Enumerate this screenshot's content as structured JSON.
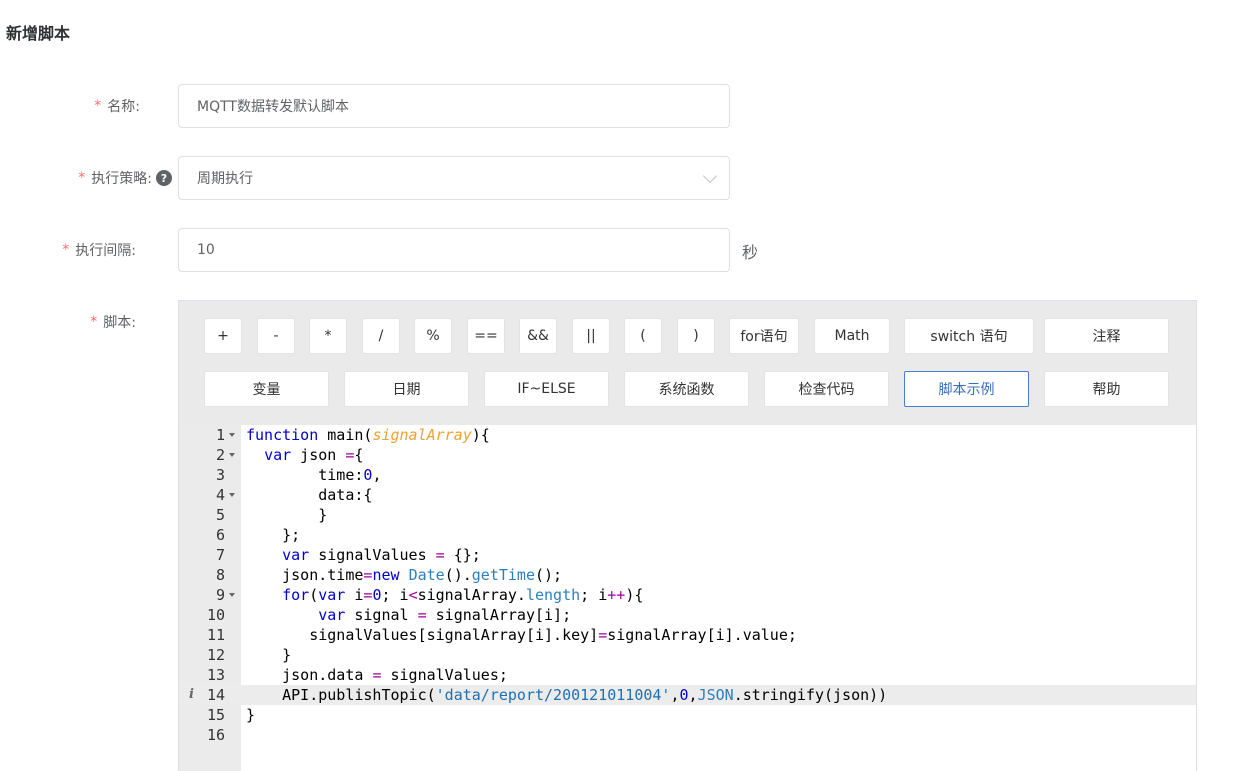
{
  "page": {
    "title": "新增脚本"
  },
  "form": {
    "name": {
      "required_mark": "*",
      "label": "名称:",
      "value": "MQTT数据转发默认脚本"
    },
    "strategy": {
      "required_mark": "*",
      "label": "执行策略:",
      "help_icon": "question-circle-icon",
      "value": "周期执行"
    },
    "interval": {
      "required_mark": "*",
      "label": "执行间隔:",
      "value": "10",
      "unit": "秒"
    },
    "script": {
      "required_mark": "*",
      "label": "脚本:"
    }
  },
  "toolbar": {
    "row1": [
      "+",
      "-",
      "*",
      "/",
      "%",
      "==",
      "&&",
      "||",
      "(",
      ")",
      "for语句",
      "Math",
      "switch 语句",
      "注释"
    ],
    "row2": [
      "变量",
      "日期",
      "IF~ELSE",
      "系统函数",
      "检查代码",
      "脚本示例",
      "帮助"
    ],
    "active": "脚本示例"
  },
  "editor": {
    "active_line": 14,
    "colors": {
      "keyword": "#0000cc",
      "param": "#f0a030",
      "operator": "#a0009a",
      "number": "#0000cc",
      "builtin": "#2b7fbf",
      "string": "#1e6fb0",
      "text": "#000000"
    },
    "lines": [
      {
        "n": "1",
        "fold": true,
        "tokens": [
          [
            "k",
            "function"
          ],
          [
            "t",
            " main("
          ],
          [
            "p",
            "signalArray"
          ],
          [
            "t",
            "){"
          ]
        ]
      },
      {
        "n": "2",
        "fold": true,
        "tokens": [
          [
            "t",
            "  "
          ],
          [
            "k",
            "var"
          ],
          [
            "t",
            " json "
          ],
          [
            "o",
            "="
          ],
          [
            "t",
            "{"
          ]
        ]
      },
      {
        "n": "3",
        "fold": false,
        "tokens": [
          [
            "t",
            "        time:"
          ],
          [
            "d",
            "0"
          ],
          [
            "t",
            ","
          ]
        ]
      },
      {
        "n": "4",
        "fold": true,
        "tokens": [
          [
            "t",
            "        data:{"
          ]
        ]
      },
      {
        "n": "5",
        "fold": false,
        "tokens": [
          [
            "t",
            "        }"
          ]
        ]
      },
      {
        "n": "6",
        "fold": false,
        "tokens": [
          [
            "t",
            "    };"
          ]
        ]
      },
      {
        "n": "7",
        "fold": false,
        "tokens": [
          [
            "t",
            "    "
          ],
          [
            "k",
            "var"
          ],
          [
            "t",
            " signalValues "
          ],
          [
            "o",
            "="
          ],
          [
            "t",
            " {};"
          ]
        ]
      },
      {
        "n": "8",
        "fold": false,
        "tokens": [
          [
            "t",
            "    json.time"
          ],
          [
            "o",
            "="
          ],
          [
            "k",
            "new"
          ],
          [
            "t",
            " "
          ],
          [
            "b",
            "Date"
          ],
          [
            "t",
            "()."
          ],
          [
            "b",
            "getTime"
          ],
          [
            "t",
            "();"
          ]
        ]
      },
      {
        "n": "9",
        "fold": true,
        "tokens": [
          [
            "t",
            "    "
          ],
          [
            "k",
            "for"
          ],
          [
            "t",
            "("
          ],
          [
            "k",
            "var"
          ],
          [
            "t",
            " i"
          ],
          [
            "o",
            "="
          ],
          [
            "d",
            "0"
          ],
          [
            "t",
            "; i"
          ],
          [
            "o",
            "<"
          ],
          [
            "t",
            "signalArray."
          ],
          [
            "b",
            "length"
          ],
          [
            "t",
            "; i"
          ],
          [
            "o",
            "++"
          ],
          [
            "t",
            "){"
          ]
        ]
      },
      {
        "n": "10",
        "fold": false,
        "tokens": [
          [
            "t",
            "        "
          ],
          [
            "k",
            "var"
          ],
          [
            "t",
            " signal "
          ],
          [
            "o",
            "="
          ],
          [
            "t",
            " signalArray[i];"
          ]
        ]
      },
      {
        "n": "11",
        "fold": false,
        "tokens": [
          [
            "t",
            "       signalValues[signalArray[i].key]"
          ],
          [
            "o",
            "="
          ],
          [
            "t",
            "signalArray[i].value;"
          ]
        ]
      },
      {
        "n": "12",
        "fold": false,
        "tokens": [
          [
            "t",
            "    }"
          ]
        ]
      },
      {
        "n": "13",
        "fold": false,
        "tokens": [
          [
            "t",
            "    json.data "
          ],
          [
            "o",
            "="
          ],
          [
            "t",
            " signalValues;"
          ]
        ]
      },
      {
        "n": "14",
        "fold": false,
        "info": "i",
        "tokens": [
          [
            "t",
            "    API.publishTopic("
          ],
          [
            "s",
            "'data/report/200121011004'"
          ],
          [
            "t",
            ","
          ],
          [
            "d",
            "0"
          ],
          [
            "t",
            ","
          ],
          [
            "b",
            "JSON"
          ],
          [
            "t",
            ".stringify(json))"
          ]
        ]
      },
      {
        "n": "15",
        "fold": false,
        "tokens": [
          [
            "t",
            "}"
          ]
        ]
      },
      {
        "n": "16",
        "fold": false,
        "tokens": []
      }
    ]
  }
}
